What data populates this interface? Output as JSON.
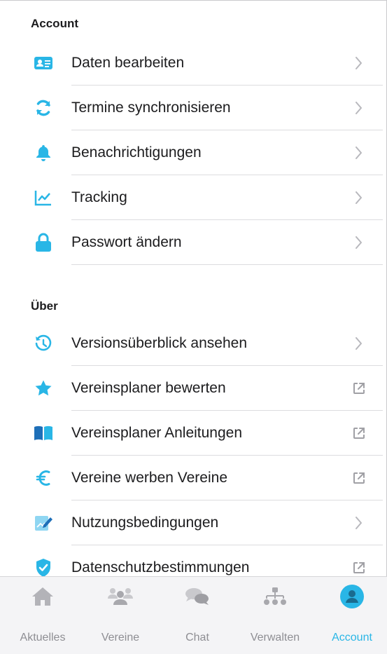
{
  "sections": {
    "account": {
      "title": "Account",
      "items": [
        {
          "label": "Daten bearbeiten",
          "icon": "id-card-icon",
          "trailing": "chevron"
        },
        {
          "label": "Termine synchronisieren",
          "icon": "sync-icon",
          "trailing": "chevron"
        },
        {
          "label": "Benachrichtigungen",
          "icon": "bell-icon",
          "trailing": "chevron"
        },
        {
          "label": "Tracking",
          "icon": "chart-line-icon",
          "trailing": "chevron"
        },
        {
          "label": "Passwort ändern",
          "icon": "lock-icon",
          "trailing": "chevron"
        }
      ]
    },
    "about": {
      "title": "Über",
      "items": [
        {
          "label": "Versionsüberblick ansehen",
          "icon": "history-icon",
          "trailing": "chevron"
        },
        {
          "label": "Vereinsplaner bewerten",
          "icon": "star-icon",
          "trailing": "external"
        },
        {
          "label": "Vereinsplaner Anleitungen",
          "icon": "book-icon",
          "trailing": "external"
        },
        {
          "label": "Vereine werben Vereine",
          "icon": "euro-icon",
          "trailing": "external"
        },
        {
          "label": "Nutzungsbedingungen",
          "icon": "document-edit-icon",
          "trailing": "chevron"
        },
        {
          "label": "Datenschutzbestimmungen",
          "icon": "shield-check-icon",
          "trailing": "external"
        }
      ]
    }
  },
  "tabbar": {
    "tabs": [
      {
        "label": "Aktuelles",
        "icon": "home-icon",
        "active": false
      },
      {
        "label": "Vereine",
        "icon": "group-icon",
        "active": false
      },
      {
        "label": "Chat",
        "icon": "chat-icon",
        "active": false
      },
      {
        "label": "Verwalten",
        "icon": "hierarchy-icon",
        "active": false
      },
      {
        "label": "Account",
        "icon": "user-icon",
        "active": true
      }
    ]
  },
  "colors": {
    "accent": "#29b6e6",
    "icon_inactive": "#b3b3b8",
    "chevron": "#b8b8bd"
  }
}
